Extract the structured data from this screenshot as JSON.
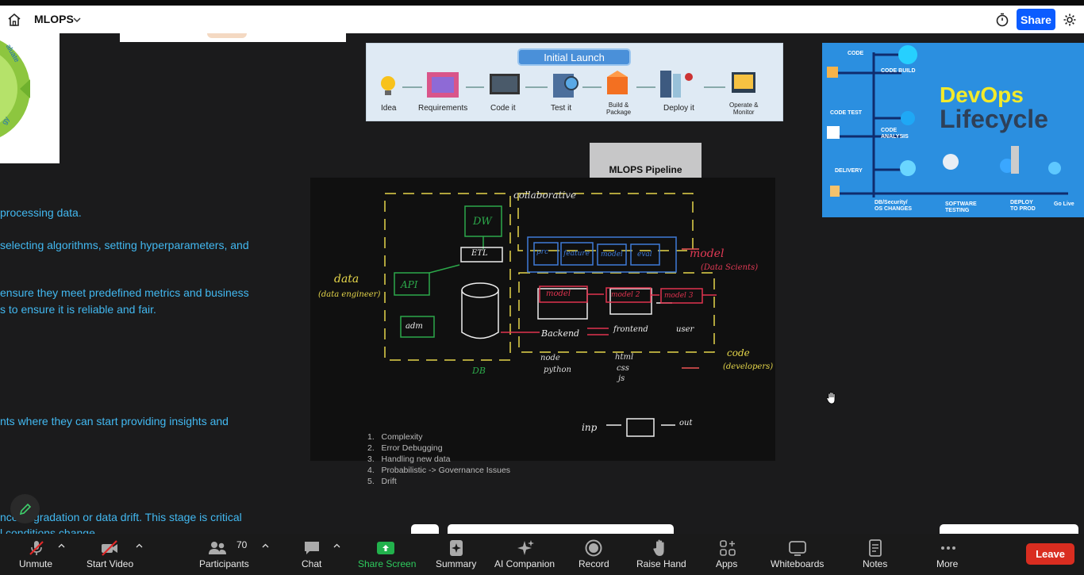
{
  "window": {
    "title": "MLOPS",
    "share_label": "Share"
  },
  "slide": {
    "left_text": [
      "processing data.",
      "selecting algorithms, setting hyperparameters, and",
      "ensure they meet predefined metrics and business",
      "s to ensure it is reliable and fair.",
      "nts where they can start providing insights and",
      "nce degradation or data drift. This stage is critical",
      "l conditions change"
    ],
    "cycle_labels": [
      "aluate",
      "gy"
    ],
    "initial_launch": {
      "title": "Initial Launch",
      "steps": [
        "Idea",
        "Requirements",
        "Code it",
        "Test it",
        "Build &\nPackage",
        "Deploy it",
        "Operate &\nMonitor"
      ]
    },
    "mlops_box": "MLOPS Pipeline",
    "devops": {
      "title_line1": "DevOps",
      "title_line2": "Lifecycle",
      "labels": [
        "CODE",
        "CODE BUILD",
        "CODE TEST",
        "CODE\nANALYSIS",
        "DELIVERY",
        "DB/Security/\nOS CHANGES",
        "SOFTWARE\nTESTING",
        "DEPLOY\nTO PROD",
        "Go Live"
      ]
    },
    "whiteboard": {
      "labels": [
        "collaborative",
        "model",
        "(Data Scients)",
        "data",
        "(data engineer)",
        "DW",
        "ETL",
        "API",
        "adm",
        "DB",
        "prc",
        "feature",
        "model",
        "eval",
        "model",
        "model 2",
        "model 3",
        "Backend",
        "frontend",
        "user",
        "node",
        "python",
        "html",
        "css",
        "js",
        "code",
        "(developers)",
        "inp",
        "out"
      ],
      "issues": [
        "Complexity",
        "Error Debugging",
        "Handling new data",
        "Probabilistic -> Governance Issues",
        "Drift"
      ]
    }
  },
  "toolbar": {
    "unmute": "Unmute",
    "start_video": "Start Video",
    "participants": "Participants",
    "participants_count": "70",
    "chat": "Chat",
    "share_screen": "Share Screen",
    "summary": "Summary",
    "ai_companion": "AI Companion",
    "record": "Record",
    "raise_hand": "Raise Hand",
    "apps": "Apps",
    "whiteboards": "Whiteboards",
    "notes": "Notes",
    "more": "More",
    "leave": "Leave"
  },
  "colors": {
    "accent": "#0b5cff",
    "share_screen": "#22b14c",
    "leave": "#d92d20",
    "slide_text": "#42b8f0"
  }
}
